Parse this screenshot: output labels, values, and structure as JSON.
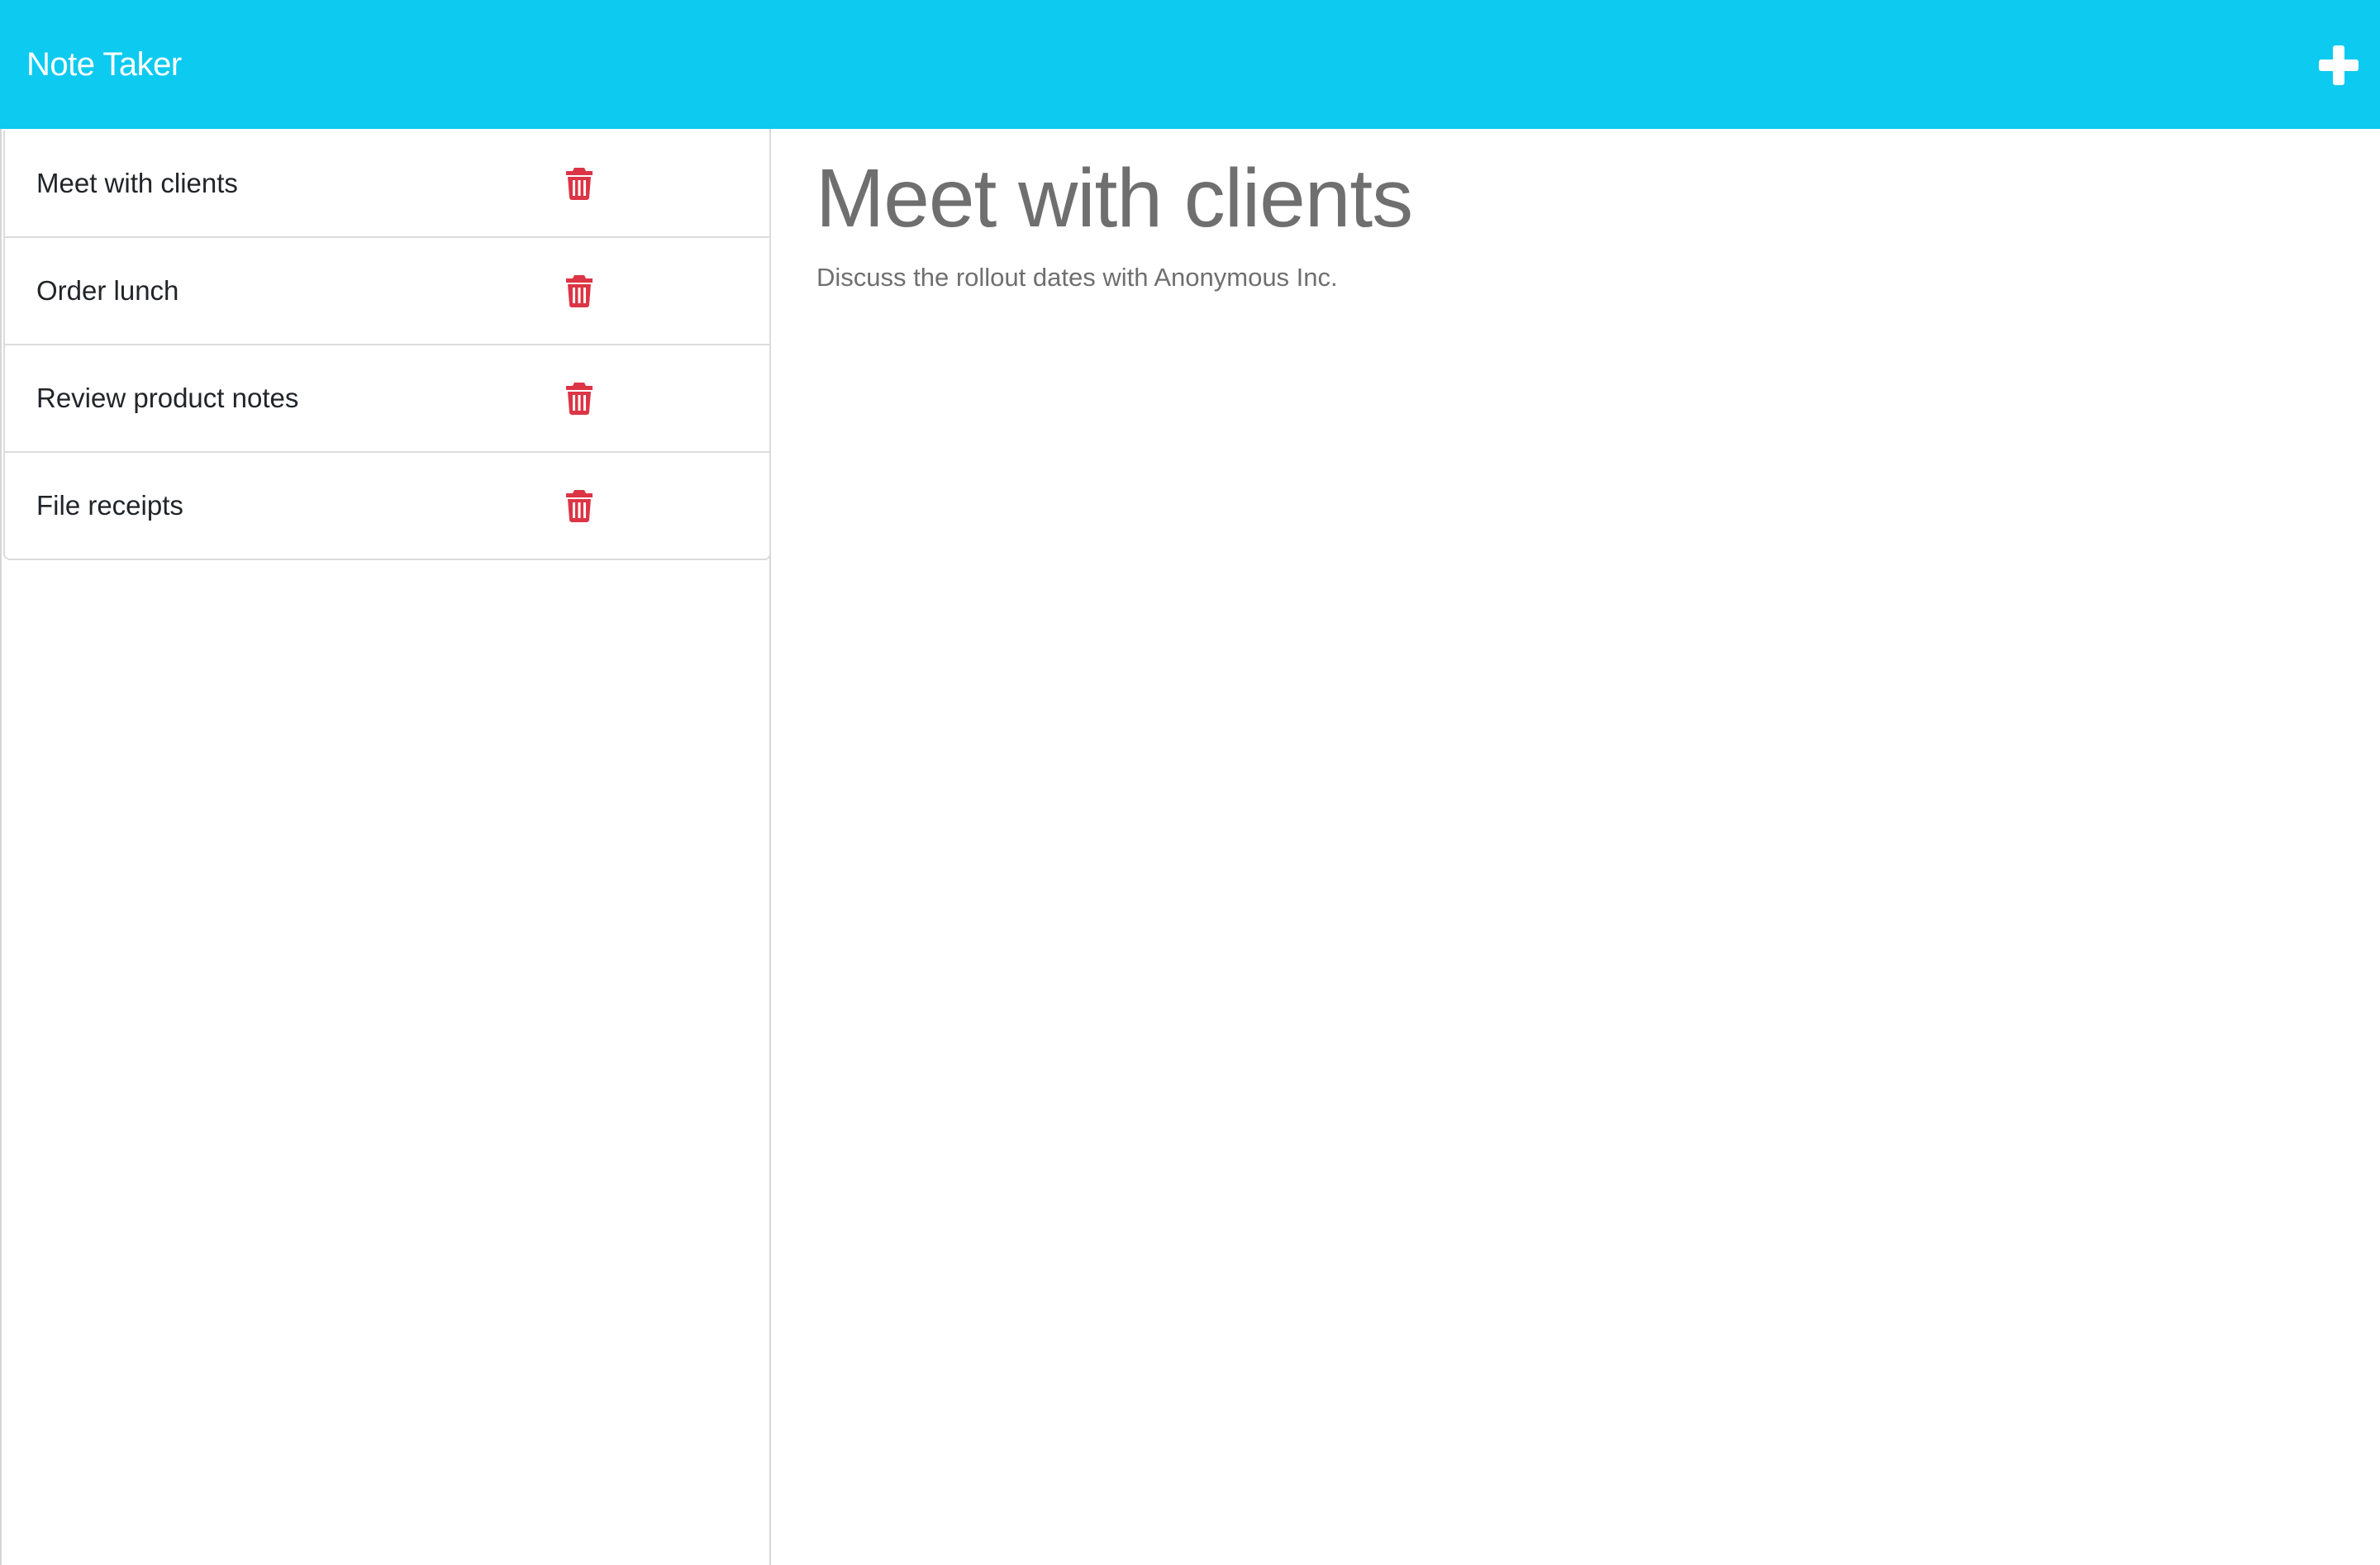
{
  "app": {
    "title": "Note Taker",
    "new_note_icon": "plus-icon",
    "accent_color": "#0dcaf0",
    "delete_color": "#dc3545"
  },
  "notes": [
    {
      "title": "Meet with clients",
      "delete_icon": "trash-icon"
    },
    {
      "title": "Order lunch",
      "delete_icon": "trash-icon"
    },
    {
      "title": "Review product notes",
      "delete_icon": "trash-icon"
    },
    {
      "title": "File receipts",
      "delete_icon": "trash-icon"
    }
  ],
  "active_note": {
    "title": "Meet with clients",
    "text": "Discuss the rollout dates with Anonymous Inc."
  }
}
